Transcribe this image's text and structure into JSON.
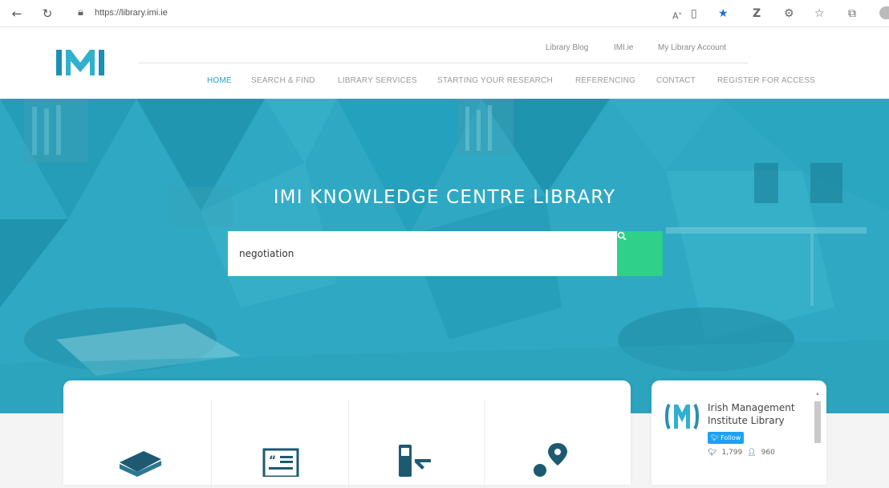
{
  "browser": {
    "url": "https://library.imi.ie",
    "icons": [
      "back-icon",
      "refresh-icon",
      "lock-icon",
      "read-aloud-icon",
      "reader-view-icon",
      "favorite-star-icon",
      "extension-icon",
      "extensions-puzzle-icon",
      "favorites-list-icon",
      "collections-icon"
    ]
  },
  "header": {
    "top_links": [
      "Library Blog",
      "IMI.ie",
      "My Library Account"
    ],
    "nav": [
      "HOME",
      "SEARCH & FIND",
      "LIBRARY SERVICES",
      "STARTING YOUR RESEARCH",
      "REFERENCING",
      "CONTACT",
      "REGISTER FOR ACCESS"
    ],
    "active_nav": "HOME"
  },
  "hero": {
    "title": "IMI KNOWLEDGE CENTRE LIBRARY",
    "search_value": "negotiation",
    "search_button_icon": "search-icon"
  },
  "features": {
    "icons": [
      "books-icon",
      "news-icon",
      "device-icon",
      "location-icon"
    ]
  },
  "twitter": {
    "name": "Irish Management Institute Library",
    "follow_label": "Follow",
    "tweets_count": "1,799",
    "followers_count": "960"
  },
  "colors": {
    "accent": "#1aa6c4",
    "hero": "#2fa9c3",
    "search_button": "#2ed08a",
    "twitter": "#1da1f2"
  }
}
